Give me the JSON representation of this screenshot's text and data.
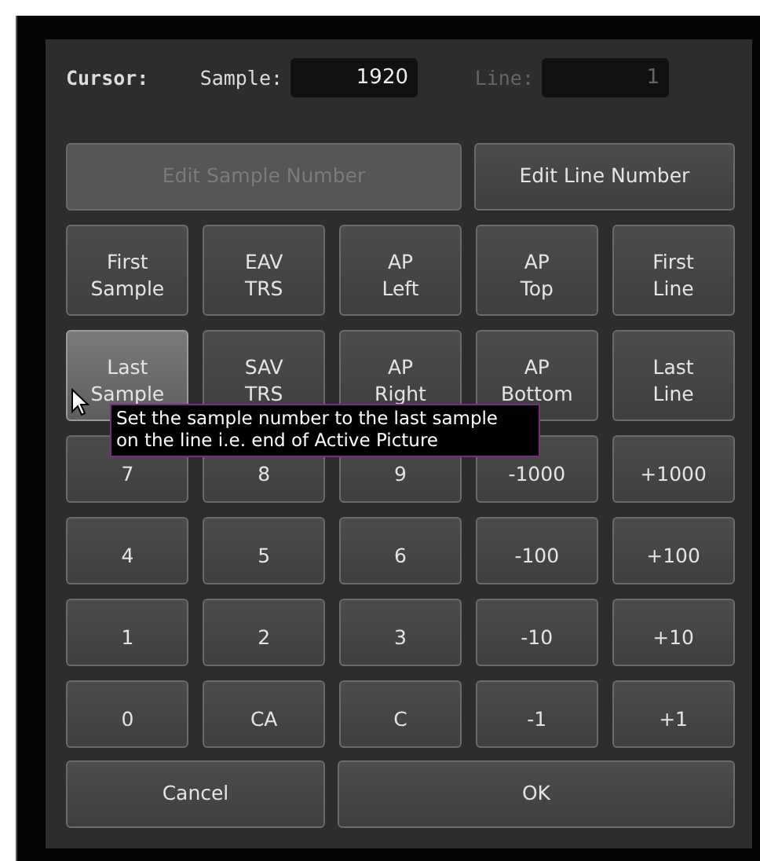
{
  "cursor": {
    "label": "Cursor:",
    "sample_label": "Sample:",
    "sample_value": "1920",
    "line_label": "Line:",
    "line_value": "1",
    "line_disabled": true
  },
  "mode_buttons": [
    {
      "label": "Edit Sample Number",
      "disabled": true
    },
    {
      "label": "Edit Line Number",
      "disabled": false
    }
  ],
  "keypad": [
    [
      {
        "label": "First\nSample",
        "hovered": false
      },
      {
        "label": "EAV\nTRS",
        "hovered": false
      },
      {
        "label": "AP\nLeft",
        "hovered": false
      },
      {
        "label": "AP\nTop",
        "hovered": false
      },
      {
        "label": "First\nLine",
        "hovered": false
      }
    ],
    [
      {
        "label": "Last\nSample",
        "hovered": true
      },
      {
        "label": "SAV\nTRS",
        "hovered": false
      },
      {
        "label": "AP\nRight",
        "hovered": false
      },
      {
        "label": "AP\nBottom",
        "hovered": false
      },
      {
        "label": "Last\nLine",
        "hovered": false
      }
    ],
    [
      {
        "label": "7",
        "hovered": false
      },
      {
        "label": "8",
        "hovered": false
      },
      {
        "label": "9",
        "hovered": false
      },
      {
        "label": "-1000",
        "hovered": false
      },
      {
        "label": "+1000",
        "hovered": false
      }
    ],
    [
      {
        "label": "4",
        "hovered": false
      },
      {
        "label": "5",
        "hovered": false
      },
      {
        "label": "6",
        "hovered": false
      },
      {
        "label": "-100",
        "hovered": false
      },
      {
        "label": "+100",
        "hovered": false
      }
    ],
    [
      {
        "label": "1",
        "hovered": false
      },
      {
        "label": "2",
        "hovered": false
      },
      {
        "label": "3",
        "hovered": false
      },
      {
        "label": "-10",
        "hovered": false
      },
      {
        "label": "+10",
        "hovered": false
      }
    ],
    [
      {
        "label": "0",
        "hovered": false
      },
      {
        "label": "CA",
        "hovered": false
      },
      {
        "label": "C",
        "hovered": false
      },
      {
        "label": "-1",
        "hovered": false
      },
      {
        "label": "+1",
        "hovered": false
      }
    ]
  ],
  "footer_buttons": [
    "Cancel",
    "OK"
  ],
  "tooltip": {
    "text": "Set the sample number to the last sample\non the line i.e. end of Active Picture"
  }
}
